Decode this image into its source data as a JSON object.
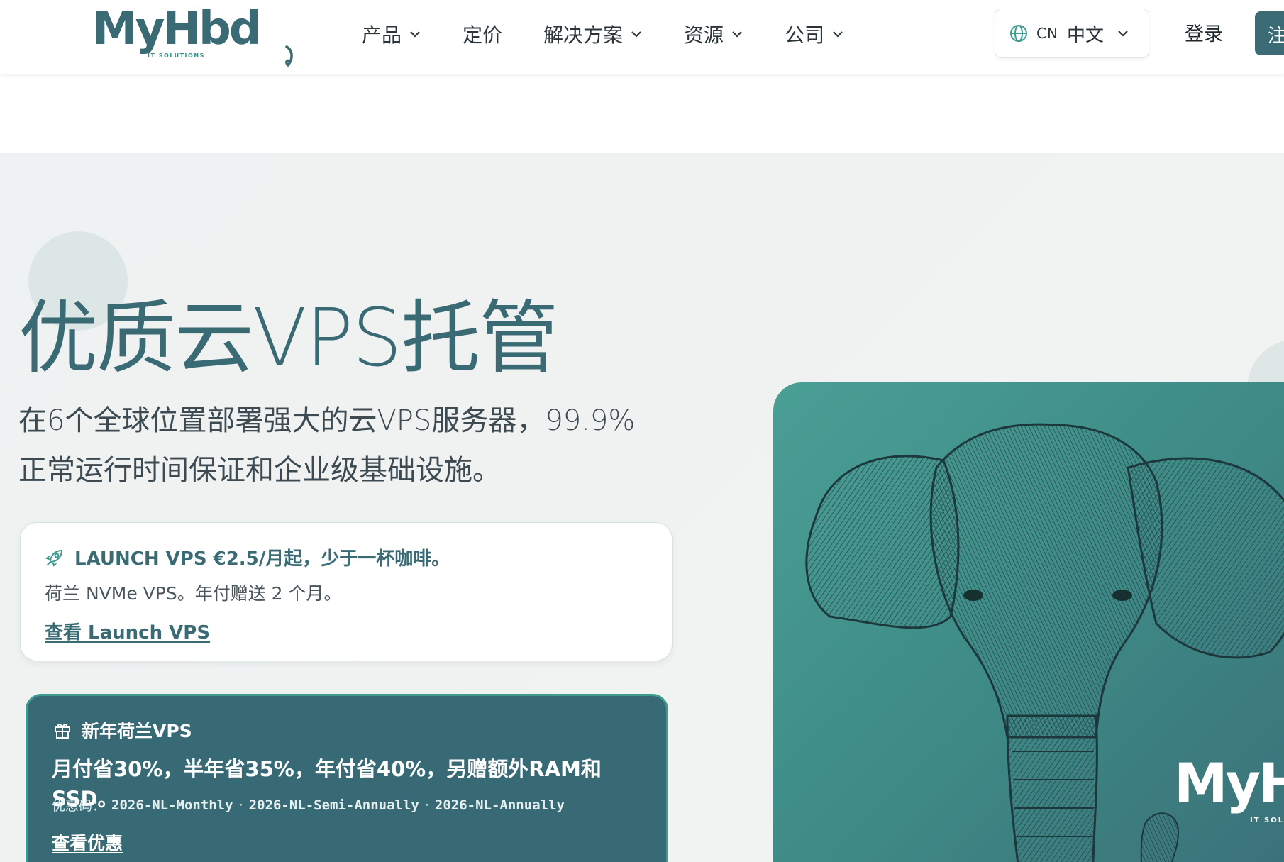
{
  "header": {
    "logo_text": "MyHbd",
    "logo_sub": "IT SOLUTIONS",
    "nav": [
      {
        "label": "产品",
        "has_dropdown": true
      },
      {
        "label": "定价",
        "has_dropdown": false
      },
      {
        "label": "解决方案",
        "has_dropdown": true
      },
      {
        "label": "资源",
        "has_dropdown": true
      },
      {
        "label": "公司",
        "has_dropdown": true
      }
    ],
    "language": {
      "code": "CN",
      "label": "中文"
    },
    "login_label": "登录",
    "register_label": "注"
  },
  "hero": {
    "title": "优质云VPS托管",
    "subtitle_line1": "在6个全球位置部署强大的云VPS服务器，99.9%",
    "subtitle_line2": "正常运行时间保证和企业级基础设施。",
    "promo": {
      "headline": "LAUNCH VPS €2.5/月起，少于一杯咖啡。",
      "text": "荷兰 NVMe VPS。年付赠送 2 个月。",
      "link": "查看 Launch VPS"
    },
    "offer": {
      "headline": "新年荷兰VPS",
      "main": "月付省30%，半年省35%，年付省40%，另赠额外RAM和SSD。",
      "codes_label": "优惠码：",
      "codes": [
        "2026-NL-Monthly",
        "2026-NL-Semi-Annually",
        "2026-NL-Annually"
      ],
      "separator": "·",
      "link": "查看优惠"
    },
    "image_logo_text": "MyH",
    "image_logo_sub": "IT SOL"
  },
  "colors": {
    "brand": "#3a6b74",
    "accent": "#3c9a8e",
    "offer_bg": "#386a76"
  }
}
